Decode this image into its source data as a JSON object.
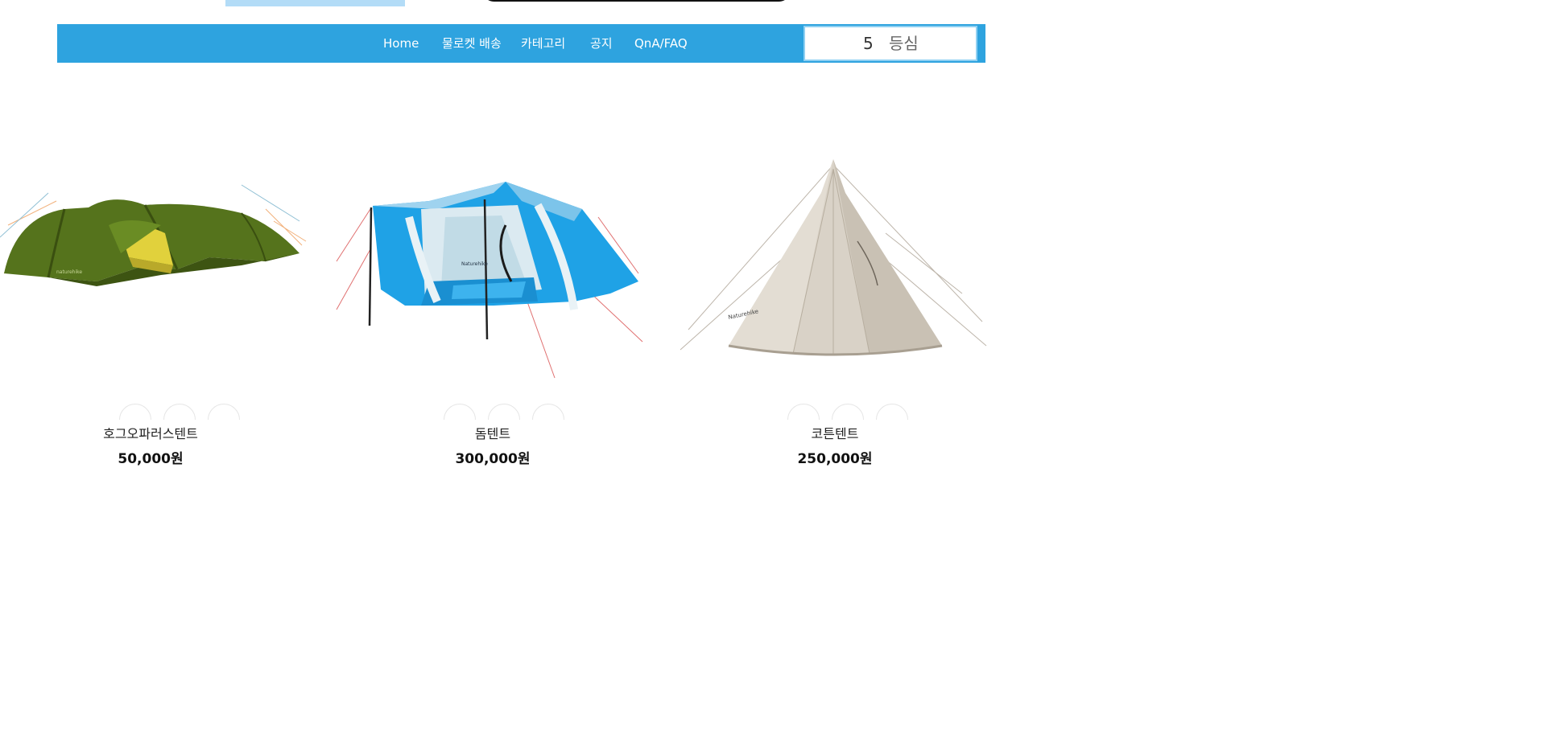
{
  "nav": {
    "items": [
      "Home",
      "물로켓 배송",
      "카테고리",
      "공지",
      "QnA/FAQ"
    ],
    "rank_number": "5",
    "rank_word": "등심"
  },
  "products": [
    {
      "name": "호그오파러스텐트",
      "price": "50,000원",
      "image": "green-tunnel-tent",
      "colors": [
        "#2f4a12",
        "#5b7a1e",
        "#e8d94a"
      ]
    },
    {
      "name": "돔텐트",
      "price": "300,000원",
      "image": "blue-dome-tent",
      "colors": [
        "#1e9fe0",
        "#c9dbe4",
        "#333333"
      ]
    },
    {
      "name": "코튼텐트",
      "price": "250,000원",
      "image": "beige-cotton-tent",
      "colors": [
        "#d8d0c4",
        "#b0a697",
        "#8a7f70"
      ]
    }
  ],
  "colors": {
    "nav_background": "#2ea3df",
    "nav_text": "#ffffff",
    "rank_box_border": "#8fd0f2"
  }
}
